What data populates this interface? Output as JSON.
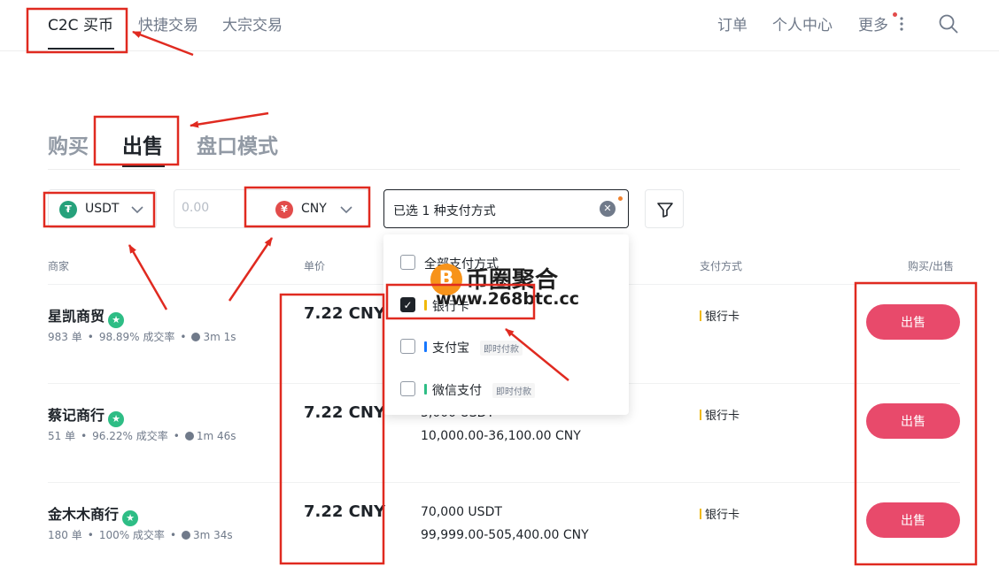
{
  "nav": {
    "items": [
      "C2C 买币",
      "快捷交易",
      "大宗交易"
    ],
    "right": [
      "订单",
      "个人中心",
      "更多"
    ]
  },
  "tabs": [
    "购买",
    "出售",
    "盘口模式"
  ],
  "filters": {
    "coin": "USDT",
    "amount_placeholder": "0.00",
    "fiat": "CNY",
    "payment_summary": "已选 1 种支付方式"
  },
  "columns": [
    "商家",
    "单价",
    "支付方式",
    "购买/出售"
  ],
  "payment_options": [
    {
      "label": "全部支付方式",
      "checked": false,
      "tag": "",
      "color": ""
    },
    {
      "label": "银行卡",
      "checked": true,
      "tag": "",
      "color": "#f0b90b"
    },
    {
      "label": "支付宝",
      "checked": false,
      "tag": "即时付款",
      "color": "#1677ff"
    },
    {
      "label": "微信支付",
      "checked": false,
      "tag": "即时付款",
      "color": "#2ebd85"
    }
  ],
  "rows": [
    {
      "merchant": "星凯商贸",
      "orders": "983 单",
      "rate": "98.89% 成交率",
      "time": "3m 1s",
      "price": "7.22 CNY",
      "qty": "",
      "limit": "",
      "method": "银行卡",
      "action": "出售"
    },
    {
      "merchant": "蔡记商行",
      "orders": "51 单",
      "rate": "96.22% 成交率",
      "time": "1m 46s",
      "price": "7.22 CNY",
      "qty": "5,000 USDT",
      "limit": "10,000.00-36,100.00 CNY",
      "method": "银行卡",
      "action": "出售"
    },
    {
      "merchant": "金木木商行",
      "orders": "180 单",
      "rate": "100% 成交率",
      "time": "3m 34s",
      "price": "7.22 CNY",
      "qty": "70,000 USDT",
      "limit": "99,999.00-505,400.00 CNY",
      "method": "银行卡",
      "action": "出售"
    }
  ],
  "watermark": {
    "title": "币圈聚合",
    "url": "www.268btc.cc"
  },
  "colors": {
    "sell": "#e84a6b",
    "verified": "#2ebd85",
    "annotation": "#e02a20",
    "text": "#1e2329",
    "muted": "#707a8a"
  },
  "icons": {
    "tether": "tether-icon",
    "yuan": "yuan-icon",
    "search": "search-icon",
    "filter": "filter-icon"
  }
}
